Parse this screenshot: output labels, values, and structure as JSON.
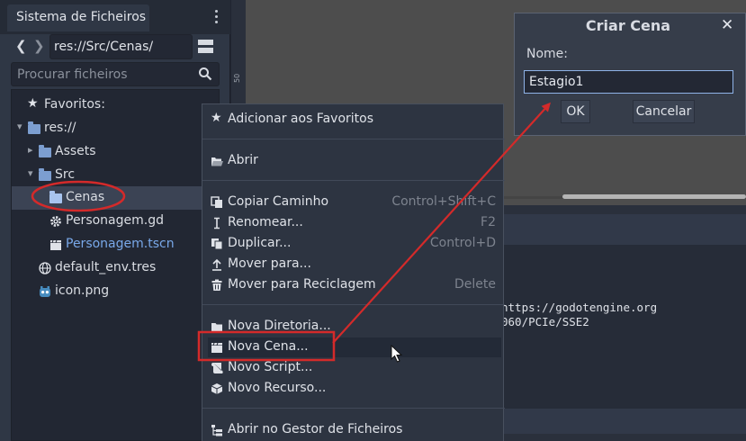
{
  "filesystem": {
    "tab_title": "Sistema de Ficheiros",
    "path": "res://Src/Cenas/",
    "search_placeholder": "Procurar ficheiros",
    "favorites_label": "Favoritos:",
    "tree": {
      "root": "res://",
      "assets": "Assets",
      "src": "Src",
      "cenas": "Cenas",
      "personagem_gd": "Personagem.gd",
      "personagem_tscn": "Personagem.tscn",
      "default_env": "default_env.tres",
      "icon_png": "icon.png"
    }
  },
  "ruler_label": "50",
  "console": {
    "line1": "https://godotengine.org",
    "line2": "060/PCIe/SSE2"
  },
  "context_menu": {
    "add_favorites": "Adicionar aos Favoritos",
    "open": "Abrir",
    "copy_path": "Copiar Caminho",
    "copy_path_shortcut": "Control+Shift+C",
    "rename": "Renomear...",
    "rename_shortcut": "F2",
    "duplicate": "Duplicar...",
    "duplicate_shortcut": "Control+D",
    "move_to": "Mover para...",
    "move_to_trash": "Mover para Reciclagem",
    "move_to_trash_shortcut": "Delete",
    "new_folder": "Nova Diretoria...",
    "new_scene": "Nova Cena...",
    "new_script": "Novo Script...",
    "new_resource": "Novo Recurso...",
    "open_file_manager": "Abrir no Gestor de Ficheiros"
  },
  "dialog": {
    "title": "Criar Cena",
    "name_label": "Nome:",
    "name_value": "Estagio1",
    "ok": "OK",
    "cancel": "Cancelar"
  },
  "colors": {
    "accent": "#8fb3e8",
    "annotation": "#d42a2a",
    "folder": "#7c9ed0",
    "scene_file": "#79a8e9"
  }
}
